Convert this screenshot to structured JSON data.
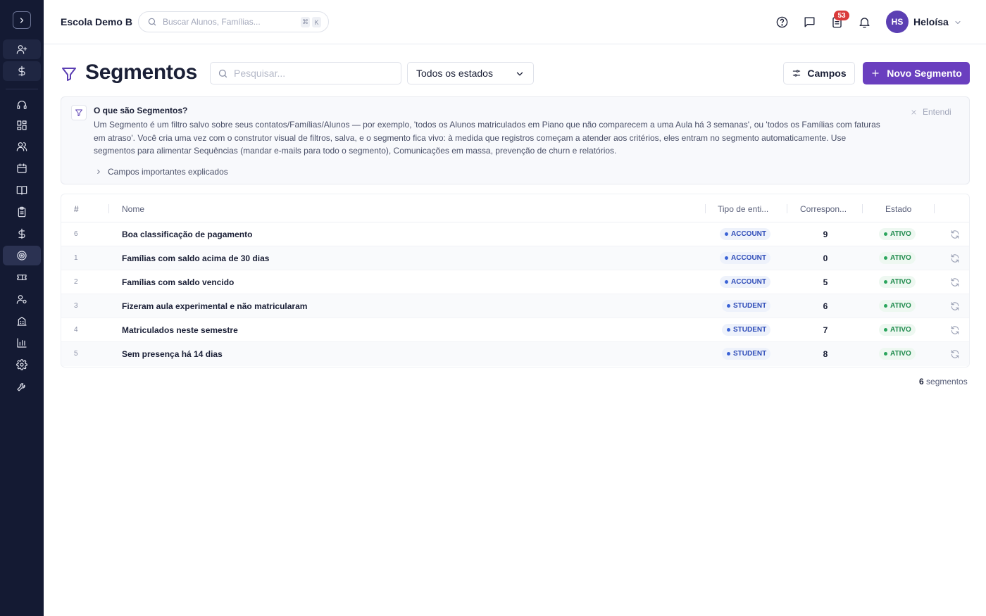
{
  "app": {
    "school_name": "Escola Demo B"
  },
  "global_search": {
    "placeholder": "Buscar Alunos, Famílias...",
    "shortcut_keys": [
      "⌘",
      "K"
    ]
  },
  "topbar": {
    "notifications_count": "53",
    "user": {
      "initials": "HS",
      "name": "Heloísa"
    }
  },
  "sidebar": {
    "items": [
      {
        "icon": "user-plus-icon"
      },
      {
        "icon": "dollar-icon"
      },
      {
        "icon": "headset-icon"
      },
      {
        "icon": "dashboard-icon"
      },
      {
        "icon": "users-icon"
      },
      {
        "icon": "calendar-icon"
      },
      {
        "icon": "book-icon"
      },
      {
        "icon": "clipboard-icon"
      },
      {
        "icon": "dollar-icon"
      },
      {
        "icon": "target-icon"
      },
      {
        "icon": "ticket-icon"
      },
      {
        "icon": "user-cog-icon"
      },
      {
        "icon": "building-icon"
      },
      {
        "icon": "bar-chart-icon"
      },
      {
        "icon": "gear-icon"
      },
      {
        "icon": "wrench-icon"
      }
    ]
  },
  "page": {
    "title": "Segmentos",
    "search_placeholder": "Pesquisar...",
    "state_filter": "Todos os estados",
    "fields_button": "Campos",
    "new_button": "Novo Segmento"
  },
  "info": {
    "title": "O que são Segmentos?",
    "body": "Um Segmento é um filtro salvo sobre seus contatos/Famílias/Alunos — por exemplo, 'todos os Alunos matriculados em Piano que não comparecem a uma Aula há 3 semanas', ou 'todos os Famílias com faturas em atraso'. Você cria uma vez com o construtor visual de filtros, salva, e o segmento fica vivo: à medida que registros começam a atender aos critérios, eles entram no segmento automaticamente. Use segmentos para alimentar Sequências (mandar e-mails para todo o segmento), Comunicações em massa, prevenção de churn e relatórios.",
    "link": "Campos importantes explicados",
    "dismiss": "Entendi"
  },
  "table": {
    "headers": {
      "num": "#",
      "name": "Nome",
      "type": "Tipo de enti...",
      "matches": "Correspon...",
      "state": "Estado"
    },
    "rows": [
      {
        "id": "6",
        "name": "Boa classificação de pagamento",
        "type": "ACCOUNT",
        "matches": "9",
        "state": "ATIVO"
      },
      {
        "id": "1",
        "name": "Famílias com saldo acima de 30 dias",
        "type": "ACCOUNT",
        "matches": "0",
        "state": "ATIVO"
      },
      {
        "id": "2",
        "name": "Famílias com saldo vencido",
        "type": "ACCOUNT",
        "matches": "5",
        "state": "ATIVO"
      },
      {
        "id": "3",
        "name": "Fizeram aula experimental e não matricularam",
        "type": "STUDENT",
        "matches": "6",
        "state": "ATIVO"
      },
      {
        "id": "4",
        "name": "Matriculados neste semestre",
        "type": "STUDENT",
        "matches": "7",
        "state": "ATIVO"
      },
      {
        "id": "5",
        "name": "Sem presença há 14 dias",
        "type": "STUDENT",
        "matches": "8",
        "state": "ATIVO"
      }
    ]
  },
  "footer": {
    "count": "6",
    "label": "segmentos"
  }
}
